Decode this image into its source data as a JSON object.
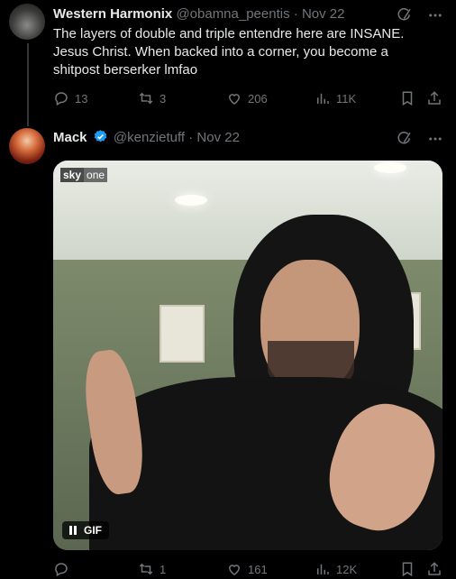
{
  "tweets": [
    {
      "name": "Western Harmonix",
      "handle": "@obamna_peentis",
      "sep": "·",
      "date": "Nov 22",
      "text": "The layers of double and triple entendre here are INSANE. Jesus Christ. When backed into a corner, you become a shitpost berserker lmfao",
      "replies": "13",
      "retweets": "3",
      "likes": "206",
      "views": "11K"
    },
    {
      "name": "Mack",
      "handle": "@kenzietuff",
      "sep": "·",
      "date": "Nov 22",
      "verified": true,
      "media": {
        "logo_primary": "sky",
        "logo_secondary": "one",
        "gif_label": "GIF"
      },
      "replies": "",
      "retweets": "1",
      "likes": "161",
      "views": "12K"
    }
  ],
  "colors": {
    "background": "#000000",
    "text": "#e7e9ea",
    "muted": "#71767b",
    "verified": "#1d9bf0"
  }
}
